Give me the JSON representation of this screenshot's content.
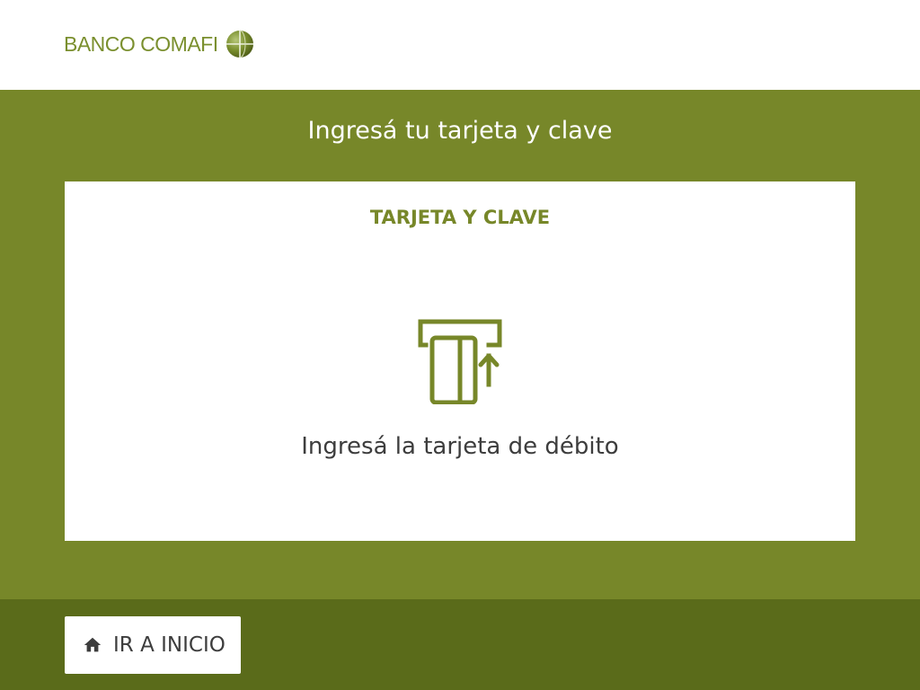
{
  "colors": {
    "brand": "#7a8f2e",
    "main_bg": "#778729",
    "footer_bg": "#5a6b1a",
    "card_bg": "#ffffff",
    "text_dark": "#3d3d3d"
  },
  "header": {
    "logo_text": "BANCO COMAFI",
    "logo_icon": "globe-icon"
  },
  "main": {
    "title": "Ingresá tu tarjeta y clave",
    "card": {
      "title": "TARJETA Y CLAVE",
      "icon": "card-insert-icon",
      "message": "Ingresá la tarjeta de débito"
    }
  },
  "footer": {
    "home_button": {
      "label": "IR A INICIO",
      "icon": "home-icon"
    }
  }
}
